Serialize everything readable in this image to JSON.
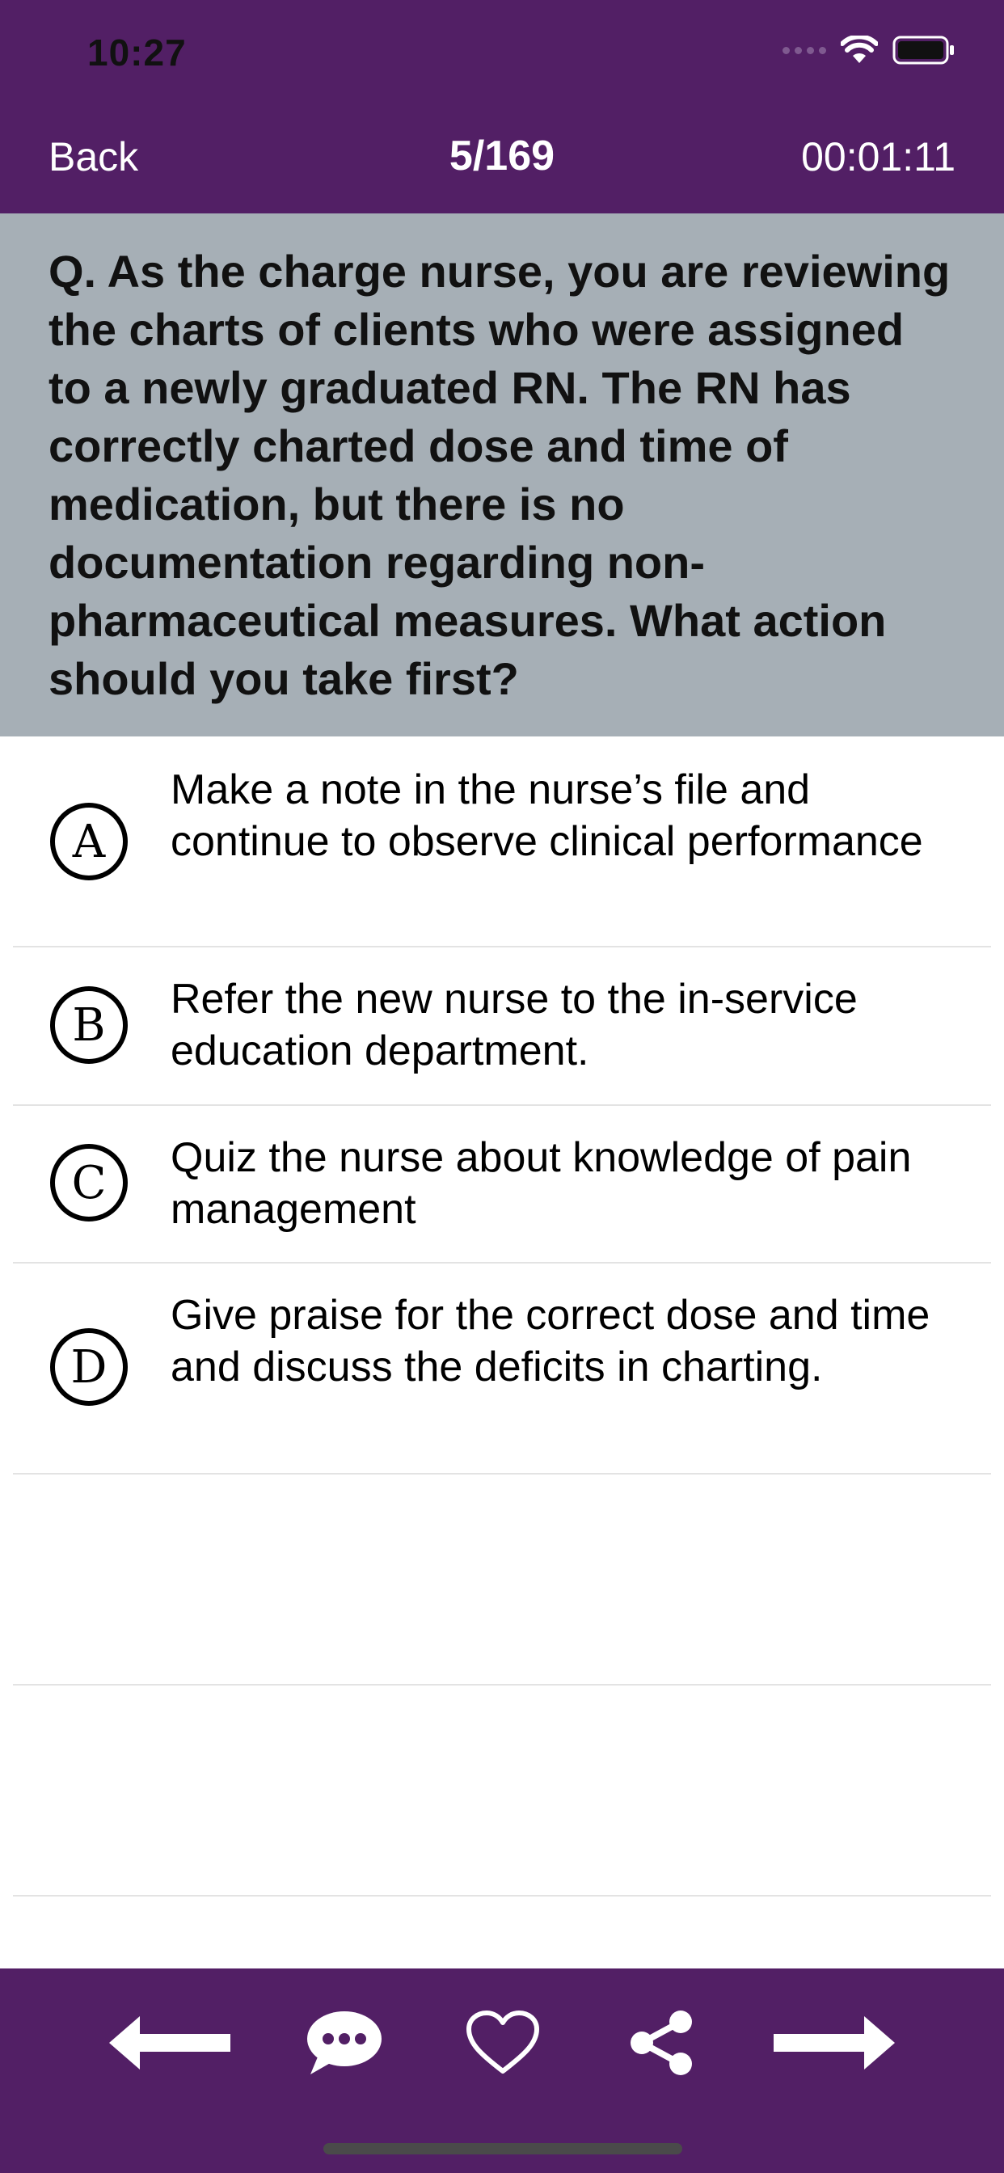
{
  "status_bar": {
    "time": "10:27"
  },
  "nav": {
    "back_label": "Back",
    "counter": "5/169",
    "timer": "00:01:11"
  },
  "question": {
    "text": "Q. As the charge nurse, you are reviewing the charts of clients who were assigned to a newly graduated RN. The RN has correctly charted dose and time of medication, but there is no documentation regarding non-pharmaceutical measures. What action should you take first?"
  },
  "options": [
    {
      "letter": "A",
      "text": "Make a note in the nurse’s file and continue to observe clinical performance"
    },
    {
      "letter": "B",
      "text": "Refer the new nurse to the in-service education department."
    },
    {
      "letter": "C",
      "text": "Quiz the nurse about knowledge of pain management"
    },
    {
      "letter": "D",
      "text": "Give praise for the correct dose and time and discuss the deficits in charting."
    }
  ],
  "toolbar": {
    "icons": [
      "arrow-left-icon",
      "comment-icon",
      "heart-icon",
      "share-icon",
      "arrow-right-icon"
    ]
  },
  "colors": {
    "header_purple": "#521f65",
    "question_bg": "#a6afb6",
    "divider": "#e3e3e3"
  }
}
